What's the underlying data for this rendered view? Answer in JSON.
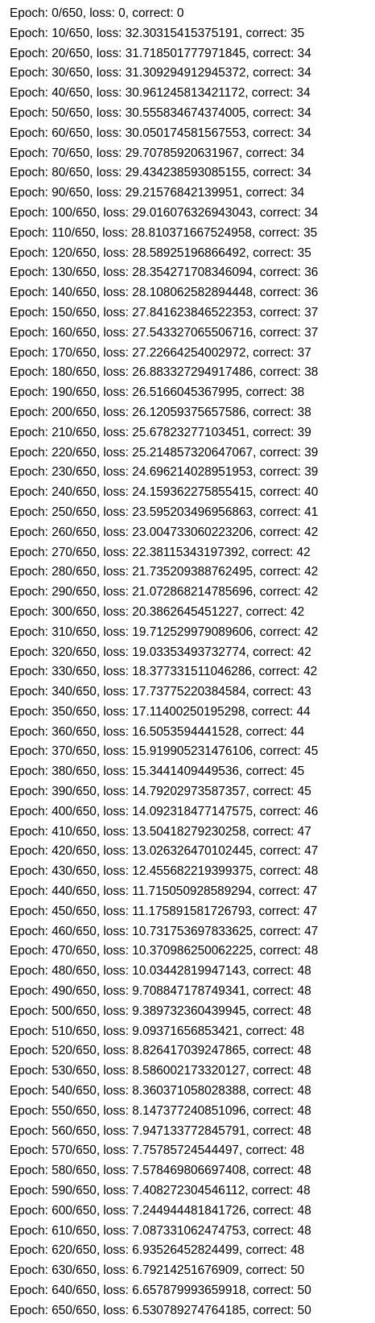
{
  "log": {
    "lines": [
      "Epoch: 0/650, loss: 0, correct: 0",
      "Epoch: 10/650, loss: 32.30315415375191, correct: 35",
      "Epoch: 20/650, loss: 31.718501777971845, correct: 34",
      "Epoch: 30/650, loss: 31.309294912945372, correct: 34",
      "Epoch: 40/650, loss: 30.961245813421172, correct: 34",
      "Epoch: 50/650, loss: 30.555834674374005, correct: 34",
      "Epoch: 60/650, loss: 30.050174581567553, correct: 34",
      "Epoch: 70/650, loss: 29.70785920631967, correct: 34",
      "Epoch: 80/650, loss: 29.434238593085155, correct: 34",
      "Epoch: 90/650, loss: 29.21576842139951, correct: 34",
      "Epoch: 100/650, loss: 29.016076326943043, correct: 34",
      "Epoch: 110/650, loss: 28.810371667524958, correct: 35",
      "Epoch: 120/650, loss: 28.58925196866492, correct: 35",
      "Epoch: 130/650, loss: 28.354271708346094, correct: 36",
      "Epoch: 140/650, loss: 28.108062582894448, correct: 36",
      "Epoch: 150/650, loss: 27.841623846522353, correct: 37",
      "Epoch: 160/650, loss: 27.543327065506716, correct: 37",
      "Epoch: 170/650, loss: 27.22664254002972, correct: 37",
      "Epoch: 180/650, loss: 26.883327294917486, correct: 38",
      "Epoch: 190/650, loss: 26.5166045367995, correct: 38",
      "Epoch: 200/650, loss: 26.12059375657586, correct: 38",
      "Epoch: 210/650, loss: 25.67823277103451, correct: 39",
      "Epoch: 220/650, loss: 25.214857320647067, correct: 39",
      "Epoch: 230/650, loss: 24.696214028951953, correct: 39",
      "Epoch: 240/650, loss: 24.159362275855415, correct: 40",
      "Epoch: 250/650, loss: 23.595203496956863, correct: 41",
      "Epoch: 260/650, loss: 23.004733060223206, correct: 42",
      "Epoch: 270/650, loss: 22.38115343197392, correct: 42",
      "Epoch: 280/650, loss: 21.735209388762495, correct: 42",
      "Epoch: 290/650, loss: 21.072868214785696, correct: 42",
      "Epoch: 300/650, loss: 20.3862645451227, correct: 42",
      "Epoch: 310/650, loss: 19.712529979089606, correct: 42",
      "Epoch: 320/650, loss: 19.03353493732774, correct: 42",
      "Epoch: 330/650, loss: 18.377331511046286, correct: 42",
      "Epoch: 340/650, loss: 17.73775220384584, correct: 43",
      "Epoch: 350/650, loss: 17.11400250195298, correct: 44",
      "Epoch: 360/650, loss: 16.5053594441528, correct: 44",
      "Epoch: 370/650, loss: 15.919905231476106, correct: 45",
      "Epoch: 380/650, loss: 15.3441409449536, correct: 45",
      "Epoch: 390/650, loss: 14.79202973587357, correct: 45",
      "Epoch: 400/650, loss: 14.092318477147575, correct: 46",
      "Epoch: 410/650, loss: 13.50418279230258, correct: 47",
      "Epoch: 420/650, loss: 13.026326470102445, correct: 47",
      "Epoch: 430/650, loss: 12.455682219399375, correct: 48",
      "Epoch: 440/650, loss: 11.715050928589294, correct: 47",
      "Epoch: 450/650, loss: 11.175891581726793, correct: 47",
      "Epoch: 460/650, loss: 10.731753697833625, correct: 47",
      "Epoch: 470/650, loss: 10.370986250062225, correct: 48",
      "Epoch: 480/650, loss: 10.03442819947143, correct: 48",
      "Epoch: 490/650, loss: 9.708847178749341, correct: 48",
      "Epoch: 500/650, loss: 9.389732360439945, correct: 48",
      "Epoch: 510/650, loss: 9.09371656853421, correct: 48",
      "Epoch: 520/650, loss: 8.826417039247865, correct: 48",
      "Epoch: 530/650, loss: 8.586002173320127, correct: 48",
      "Epoch: 540/650, loss: 8.360371058028388, correct: 48",
      "Epoch: 550/650, loss: 8.147377240851096, correct: 48",
      "Epoch: 560/650, loss: 7.947133772845791, correct: 48",
      "Epoch: 570/650, loss: 7.75785724544497, correct: 48",
      "Epoch: 580/650, loss: 7.578469806697408, correct: 48",
      "Epoch: 590/650, loss: 7.408272304546112, correct: 48",
      "Epoch: 600/650, loss: 7.244944481841726, correct: 48",
      "Epoch: 610/650, loss: 7.087331062474753, correct: 48",
      "Epoch: 620/650, loss: 6.93526452824499, correct: 48",
      "Epoch: 630/650, loss: 6.79214251676909, correct: 50",
      "Epoch: 640/650, loss: 6.657879993659918, correct: 50",
      "Epoch: 650/650, loss: 6.530789274764185, correct: 50"
    ]
  }
}
